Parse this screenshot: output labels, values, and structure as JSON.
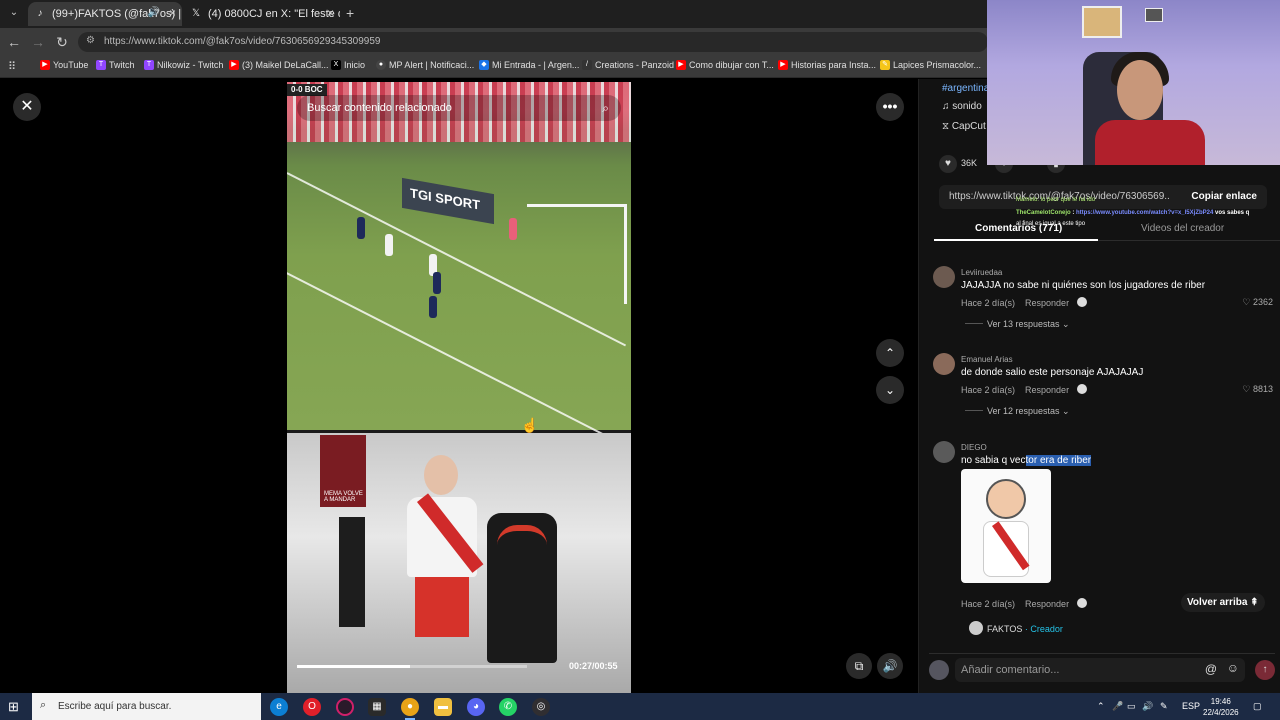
{
  "browser": {
    "tabs": [
      {
        "label": "(99+)FAKTOS (@fak7os) | T",
        "favicon": "tiktok-icon",
        "muted_icon": "speaker-icon"
      },
      {
        "label": "(4) 0800CJ en X: \"El feste de \"lo",
        "favicon": "x-icon"
      }
    ],
    "url_domain": "https://www.tiktok.com",
    "url_path": "/@fak7os/video/7630656929345309959",
    "bookmarks": [
      {
        "label": "YouTube",
        "color": "#ff0000"
      },
      {
        "label": "Twitch",
        "color": "#9146ff"
      },
      {
        "label": "Nilkowiz - Twitch",
        "color": "#9146ff"
      },
      {
        "label": "(3) Maikel DeLaCall...",
        "color": "#ff0000"
      },
      {
        "label": "Inicio",
        "color": "#000000"
      },
      {
        "label": "MP Alert | Notificaci...",
        "color": "#444444"
      },
      {
        "label": "Mi Entrada - | Argen...",
        "color": "#1a73e8"
      },
      {
        "label": "Creations - Panzoid",
        "color": "#333333"
      },
      {
        "label": "Como dibujar con T...",
        "color": "#ff0000"
      },
      {
        "label": "Historias para Insta...",
        "color": "#ff0000"
      },
      {
        "label": "Lapices Prismacolor...",
        "color": "#f5c518"
      }
    ]
  },
  "video": {
    "search_placeholder": "Buscar contenido relacionado",
    "scorebug": "0-0  BOC",
    "ad_text": "TGI SPORT",
    "inset_text": "MEMA VOLVE A MANDAR",
    "timecode": "00:27/00:55",
    "progress": 0.49
  },
  "panel": {
    "hashtag": "#argentina",
    "sound": "sonido",
    "capcut": "CapCut",
    "likes": "36K",
    "link": "https://www.tiktok.com/@fak7os/video/76306569...",
    "copy_label": "Copiar enlace",
    "tab_comments": "Comentarios (771)",
    "tab_creator": "Videos del creador",
    "comments": [
      {
        "user": "Leviiruedaa",
        "text": "JAJAJJA no sabe ni quiénes son los jugadores de riber",
        "time": "Hace 2 día(s)",
        "reply": "Responder",
        "likes": "2362",
        "replies": "Ver 13 respuestas"
      },
      {
        "user": "Emanuel Arias",
        "text": "de donde salio este personaje AJAJAJAJ",
        "time": "Hace 2 día(s)",
        "reply": "Responder",
        "likes": "8813",
        "replies": "Ver 12 respuestas"
      },
      {
        "user": "DIEGO",
        "text_a": "no sabia q vec",
        "text_b": "tor era de riber",
        "time": "Hace 2 día(s)",
        "reply": "Responder"
      }
    ],
    "back_to_top": "Volver arriba",
    "creator_name": "FAKTOS",
    "creator_tag": "· Creador",
    "add_comment_placeholder": "Añadir comentario..."
  },
  "stream_chat": {
    "line1": "Mamelo: lo peor que le ha ido",
    "line2_name": "TheCamelotConejo",
    "line2_url": "https://www.youtube.com/watch?v=x_l5XjZbP24",
    "line2_tail": "vos sabes q",
    "line3": "al final es igual a este tipo"
  },
  "taskbar": {
    "search_placeholder": "Escribe aquí para buscar.",
    "lang": "ESP",
    "time": "19:46",
    "date": "22/4/2026"
  }
}
